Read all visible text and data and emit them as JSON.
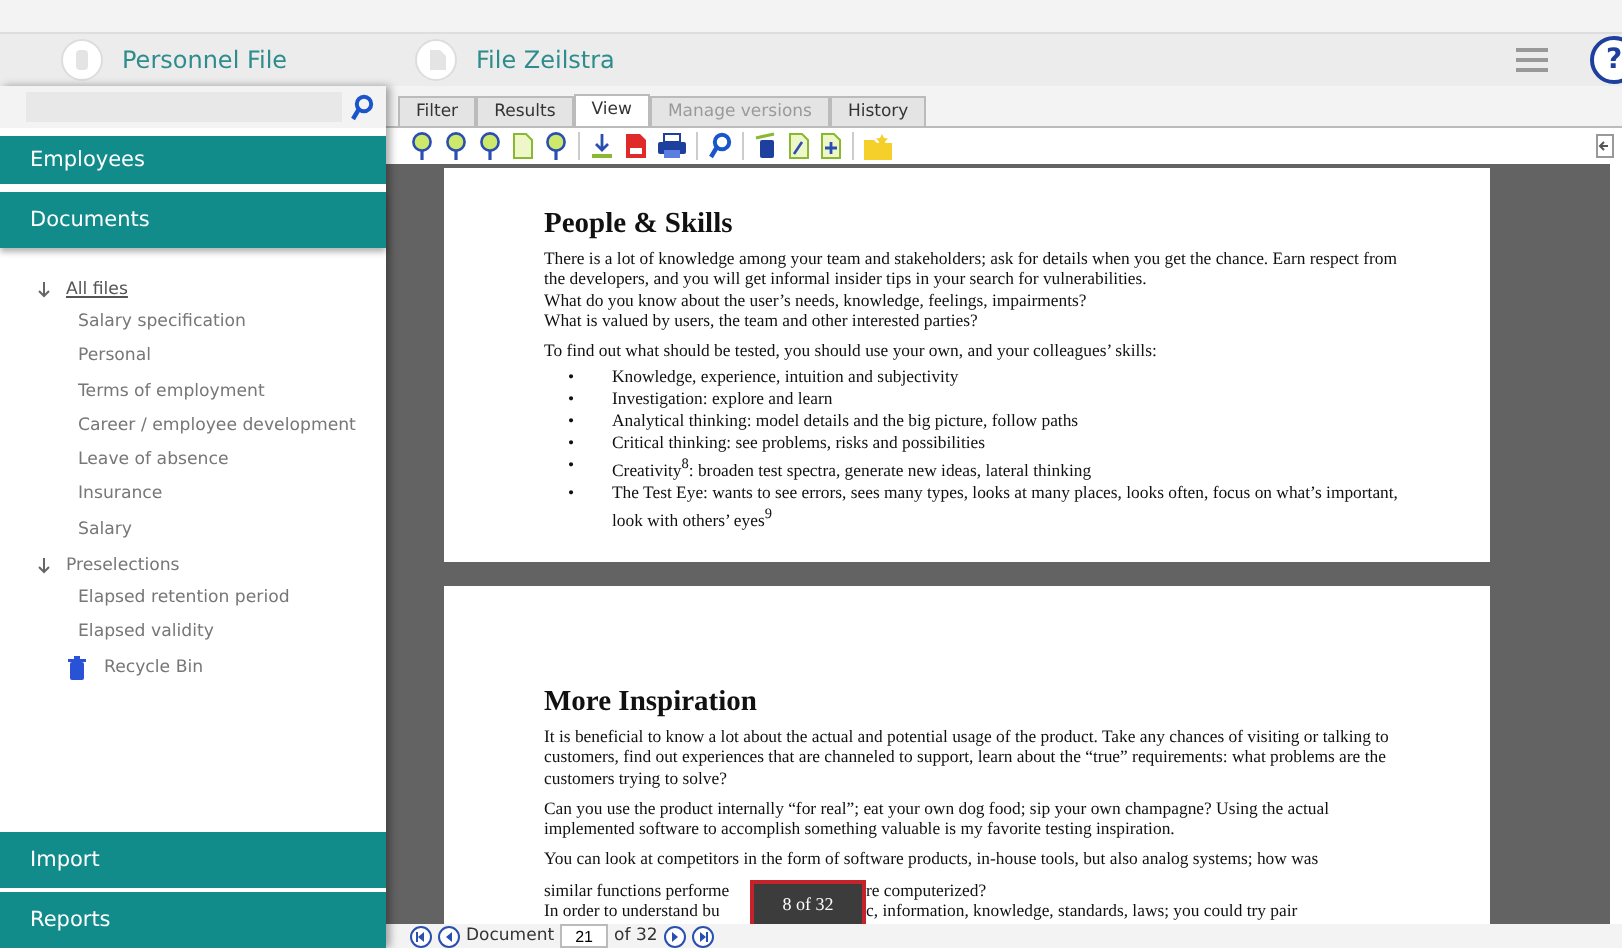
{
  "titlebar": {
    "left_title": "Personnel File",
    "right_title": "File Zeilstra",
    "help": "?"
  },
  "sidebar": {
    "sections_top": [
      {
        "label": "Employees",
        "selected": false
      },
      {
        "label": "Documents",
        "selected": true
      }
    ],
    "tree": [
      {
        "label": "All files",
        "selected": true,
        "expanded": true,
        "children": [
          {
            "label": "Salary specification"
          },
          {
            "label": "Personal"
          },
          {
            "label": "Terms of employment"
          },
          {
            "label": "Career / employee development"
          },
          {
            "label": "Leave of absence"
          },
          {
            "label": "Insurance"
          },
          {
            "label": "Salary"
          }
        ]
      },
      {
        "label": "Preselections",
        "selected": false,
        "expanded": true,
        "children": [
          {
            "label": "Elapsed retention period"
          },
          {
            "label": "Elapsed validity"
          }
        ]
      }
    ],
    "recycle_bin": "Recycle Bin",
    "sections_bottom": [
      {
        "label": "Import"
      },
      {
        "label": "Reports"
      }
    ]
  },
  "tabs": [
    {
      "label": "Filter",
      "selected": false,
      "disabled": false
    },
    {
      "label": "Results",
      "selected": false,
      "disabled": false
    },
    {
      "label": "View",
      "selected": true,
      "disabled": false
    },
    {
      "label": "Manage versions",
      "selected": false,
      "disabled": true
    },
    {
      "label": "History",
      "selected": false,
      "disabled": false
    }
  ],
  "pages": [
    {
      "heading": "People & Skills",
      "blocks": [
        {
          "kind": "para",
          "text": "There is a lot of knowledge among your team and stakeholders; ask for details when you get the chance. Earn respect from the developers, and you will get informal insider tips in your search for vulnerabilities."
        },
        {
          "kind": "line",
          "text": "What do you know about the user’s needs, knowledge, feelings, impairments?"
        },
        {
          "kind": "line",
          "text": "What is valued by users, the team and other interested parties?"
        },
        {
          "kind": "para",
          "text": "To find out what should be tested, you should use your own, and your colleagues’ skills:"
        },
        {
          "kind": "bullets",
          "marker": "•",
          "items": [
            "Knowledge, experience, intuition and subjectivity",
            "Investigation: explore and learn",
            "Analytical thinking: model details and the big picture, follow paths",
            "Critical thinking: see problems, risks and possibilities",
            "Creativity$^{8}$: broaden test spectra, generate new ideas, lateral thinking",
            "The Test Eye: wants to see errors, sees many types, looks at many places, looks often, focus on what’s important, look with others’ eyes$^{9}$"
          ]
        }
      ]
    },
    {
      "heading": "More Inspiration",
      "blocks": [
        {
          "kind": "para",
          "text": "It is beneficial to know a lot about the actual and potential usage of the product. Take any chances of visiting or talking to customers, find out experiences that are channeled to support, learn about the “true” requirements: what problems are the customers trying to solve?"
        },
        {
          "kind": "para",
          "text": "Can you use the product internally “for real”; eat your own dog food; sip your own champagne? Using the actual implemented software to accomplish something valuable is my favorite testing inspiration."
        },
        {
          "kind": "para",
          "text": "You can look at competitors in the form of software products, in-house tools, but also analog systems; how was"
        },
        {
          "kind": "split",
          "before": "similar functions performe",
          "after": "re computerized?"
        },
        {
          "kind": "split",
          "before": "In order to understand bu",
          "after": "c, information, knowledge, standards, laws; you could try pair"
        }
      ]
    }
  ],
  "page_badge": "8 of 32",
  "navigator": {
    "label": "Document",
    "value": "21",
    "total": "of 32"
  }
}
